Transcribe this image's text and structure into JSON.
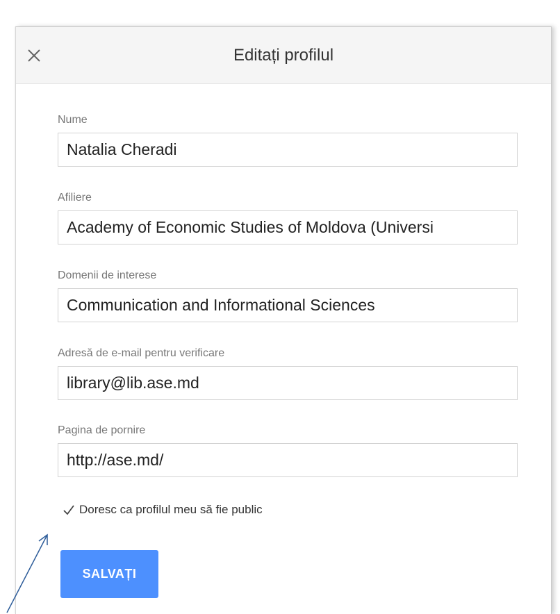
{
  "dialog": {
    "title": "Editați profilul",
    "close_icon": "close-icon"
  },
  "fields": {
    "name": {
      "label": "Nume",
      "value": "Natalia Cheradi"
    },
    "affiliation": {
      "label": "Afiliere",
      "value": "Academy of Economic Studies of Moldova (Universi"
    },
    "interests": {
      "label": "Domenii de interese",
      "value": "Communication and Informational Sciences"
    },
    "email": {
      "label": "Adresă de e-mail pentru verificare",
      "value": "library@lib.ase.md"
    },
    "homepage": {
      "label": "Pagina de pornire",
      "value": "http://ase.md/"
    }
  },
  "public_checkbox": {
    "label": "Doresc ca profilul meu să fie public",
    "checked": true,
    "icon": "checkmark-icon"
  },
  "save_button": {
    "label": "SALVAȚI"
  },
  "colors": {
    "accent": "#4d90fe",
    "header_bg": "#f5f5f5",
    "annotation_arrow": "#2e5d9a"
  }
}
